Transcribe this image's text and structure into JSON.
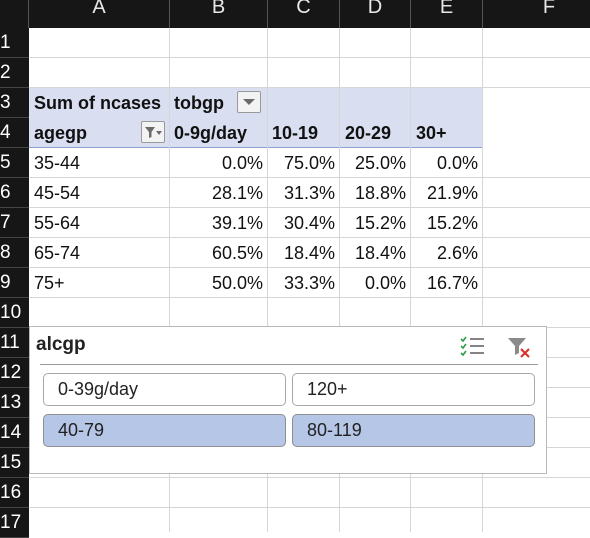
{
  "columns": [
    "A",
    "B",
    "C",
    "D",
    "E",
    "F"
  ],
  "rows": [
    "1",
    "2",
    "3",
    "4",
    "5",
    "6",
    "7",
    "8",
    "9",
    "10",
    "11",
    "12",
    "13",
    "14",
    "15",
    "16",
    "17"
  ],
  "pivot": {
    "value_field": "Sum of ncases",
    "column_field": "tobgp",
    "row_field": "agegp",
    "column_headers": [
      "0-9g/day",
      "10-19",
      "20-29",
      "30+"
    ],
    "data_rows": [
      {
        "label": "35-44",
        "values": [
          "0.0%",
          "75.0%",
          "25.0%",
          "0.0%"
        ]
      },
      {
        "label": "45-54",
        "values": [
          "28.1%",
          "31.3%",
          "18.8%",
          "21.9%"
        ]
      },
      {
        "label": "55-64",
        "values": [
          "39.1%",
          "30.4%",
          "15.2%",
          "15.2%"
        ]
      },
      {
        "label": "65-74",
        "values": [
          "60.5%",
          "18.4%",
          "18.4%",
          "2.6%"
        ]
      },
      {
        "label": "75+",
        "values": [
          "50.0%",
          "33.3%",
          "0.0%",
          "16.7%"
        ]
      }
    ]
  },
  "slicer": {
    "title": "alcgp",
    "items": [
      {
        "label": "0-39g/day",
        "selected": false
      },
      {
        "label": "120+",
        "selected": false
      },
      {
        "label": "40-79",
        "selected": true
      },
      {
        "label": "80-119",
        "selected": true
      }
    ]
  },
  "colors": {
    "header_bg": "#161616",
    "pivot_header_bg": "#d9dff1",
    "slicer_selected": "#b5c6e7",
    "clear_filter_red": "#d93025",
    "multiselect_green": "#2e9d4a"
  }
}
